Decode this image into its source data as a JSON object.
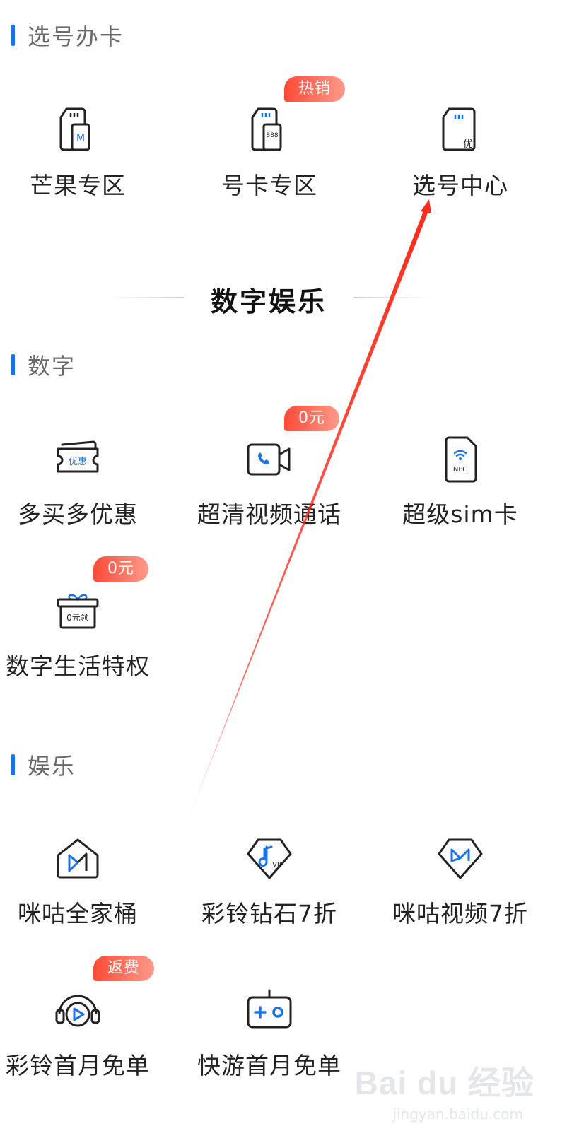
{
  "sections": {
    "xuanhao": {
      "title": "选号办卡"
    },
    "digital_entertainment": {
      "title": "数字娱乐"
    },
    "shuzi": {
      "title": "数字"
    },
    "yule": {
      "title": "娱乐"
    }
  },
  "items": {
    "mango": {
      "label": "芒果专区",
      "icon": "sim-card-m-icon"
    },
    "number_card": {
      "label": "号卡专区",
      "icon": "sim-card-888-icon",
      "badge": "热销"
    },
    "number_center": {
      "label": "选号中心",
      "icon": "sim-card-you-icon"
    },
    "discount": {
      "label": "多买多优惠",
      "icon": "coupon-icon",
      "icon_text": "优惠"
    },
    "video_call": {
      "label": "超清视频通话",
      "icon": "video-call-icon",
      "badge": "0元"
    },
    "super_sim": {
      "label": "超级sim卡",
      "icon": "nfc-sim-icon",
      "icon_text": "NFC"
    },
    "digital_life": {
      "label": "数字生活特权",
      "icon": "gift-box-icon",
      "icon_text": "0元领",
      "badge": "0元"
    },
    "migu_family": {
      "label": "咪咕全家桶",
      "icon": "migu-home-icon"
    },
    "ringtone_diamond": {
      "label": "彩铃钻石7折",
      "icon": "music-vip-icon",
      "icon_text": "VIP"
    },
    "migu_video": {
      "label": "咪咕视频7折",
      "icon": "migu-diamond-icon"
    },
    "ringtone_first": {
      "label": "彩铃首月免单",
      "icon": "headphone-play-icon",
      "badge": "返费"
    },
    "game_first": {
      "label": "快游首月免单",
      "icon": "gamepad-icon"
    }
  },
  "sim_888_text": "888",
  "sim_m_text": "M",
  "sim_you_text": "优",
  "watermark": {
    "main": "Bai du 经验",
    "sub": "jingyan.baidu.com"
  },
  "colors": {
    "accent": "#1a73e8",
    "badge_start": "#ff4a37",
    "badge_end": "#ff9a8a",
    "arrow": "#ff2a1a"
  }
}
